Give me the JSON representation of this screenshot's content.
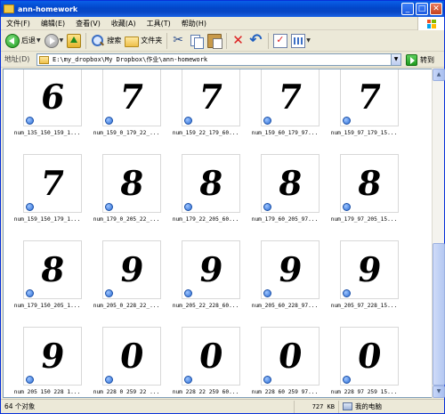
{
  "window": {
    "title": "ann-homework",
    "buttons": {
      "minimize": "_",
      "maximize": "□",
      "close": "✕"
    }
  },
  "menu": [
    "文件(F)",
    "编辑(E)",
    "查看(V)",
    "收藏(A)",
    "工具(T)",
    "帮助(H)"
  ],
  "toolbar": {
    "back_label": "后退",
    "search_label": "搜索",
    "folders_label": "文件夹",
    "icons": [
      "back-icon",
      "forward-icon",
      "up-folder-icon",
      "search-icon",
      "folders-icon",
      "cut-icon",
      "copy-icon",
      "paste-icon",
      "delete-icon",
      "undo-icon",
      "properties-icon",
      "views-icon"
    ]
  },
  "address": {
    "label": "地址(D)",
    "value": "E:\\my_dropbox\\My Dropbox\\作业\\ann-homework",
    "go_label": "转到"
  },
  "files": [
    {
      "name": "num_135_150_159_1...",
      "digit": "6"
    },
    {
      "name": "num_159_0_179_22_...",
      "digit": "7"
    },
    {
      "name": "num_159_22_179_60...",
      "digit": "7"
    },
    {
      "name": "num_159_60_179_97...",
      "digit": "7"
    },
    {
      "name": "num_159_97_179_15...",
      "digit": "7"
    },
    {
      "name": "num_159_150_179_1...",
      "digit": "7"
    },
    {
      "name": "num_179_0_205_22_...",
      "digit": "8"
    },
    {
      "name": "num_179_22_205_60...",
      "digit": "8"
    },
    {
      "name": "num_179_60_205_97...",
      "digit": "8"
    },
    {
      "name": "num_179_97_205_15...",
      "digit": "8"
    },
    {
      "name": "num_179_150_205_1...",
      "digit": "8"
    },
    {
      "name": "num_205_0_228_22_...",
      "digit": "9"
    },
    {
      "name": "num_205_22_228_60...",
      "digit": "9"
    },
    {
      "name": "num_205_60_228_97...",
      "digit": "9"
    },
    {
      "name": "num_205_97_228_15...",
      "digit": "9"
    },
    {
      "name": "num 205 150 228 1...",
      "digit": "9"
    },
    {
      "name": "num 228 0 259 22 ...",
      "digit": "0"
    },
    {
      "name": "num 228 22 259 60...",
      "digit": "0"
    },
    {
      "name": "num 228 60 259 97...",
      "digit": "0"
    },
    {
      "name": "num 228 97 259 15...",
      "digit": "0"
    }
  ],
  "status": {
    "count": "64 个对象",
    "size": "727 KB",
    "location": "我的电脑"
  },
  "colors": {
    "titlebar": "#0a48c4",
    "background": "#ece9d8",
    "content": "#ffffff"
  }
}
